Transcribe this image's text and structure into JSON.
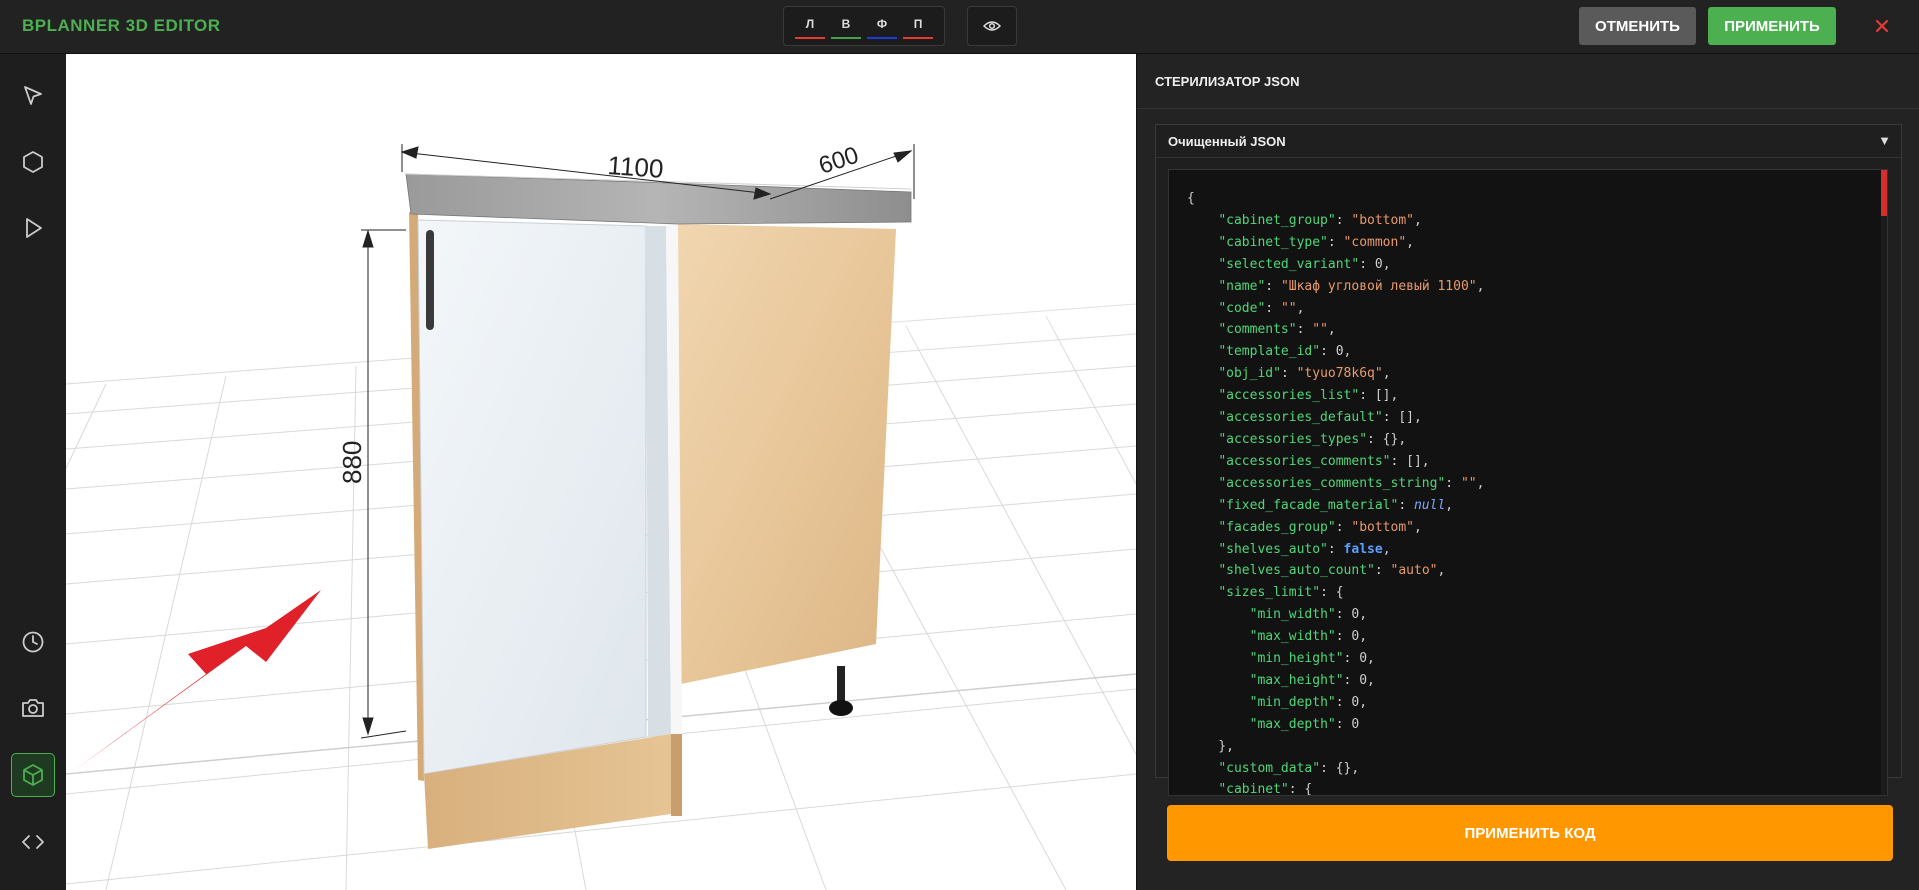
{
  "header": {
    "title": "BPLANNER 3D EDITOR",
    "view_buttons": [
      {
        "label": "Л",
        "color": "#e53935"
      },
      {
        "label": "В",
        "color": "#43a047"
      },
      {
        "label": "Ф",
        "color": "#1e3ad6"
      },
      {
        "label": "П",
        "color": "#e53935"
      }
    ],
    "eye_icon": "eye-icon",
    "cancel_label": "ОТМЕНИТЬ",
    "apply_label": "ПРИМЕНИТЬ",
    "close_icon": "close-icon"
  },
  "sidebar": {
    "tools": [
      {
        "name": "select-tool",
        "icon": "cursor-icon"
      },
      {
        "name": "shape-tool",
        "icon": "hexagon-icon"
      },
      {
        "name": "play-tool",
        "icon": "play-icon"
      },
      {
        "name": "history-tool",
        "icon": "clock-icon"
      },
      {
        "name": "camera-tool",
        "icon": "camera-icon"
      },
      {
        "name": "cube-tool",
        "icon": "cube-icon",
        "active": true
      },
      {
        "name": "code-tool",
        "icon": "code-icon"
      }
    ]
  },
  "viewport": {
    "dim_width": "1100",
    "dim_depth": "600",
    "dim_height": "880"
  },
  "panel": {
    "title": "СТЕРИЛИЗАТОР JSON",
    "accordion_title": "Очищенный JSON",
    "accordion_arrow": "▼",
    "code_lines": [
      [
        {
          "t": "p",
          "v": "{"
        }
      ],
      [
        {
          "t": "p",
          "v": "    "
        },
        {
          "t": "k",
          "v": "\"cabinet_group\""
        },
        {
          "t": "p",
          "v": ": "
        },
        {
          "t": "s",
          "v": "\"bottom\""
        },
        {
          "t": "p",
          "v": ","
        }
      ],
      [
        {
          "t": "p",
          "v": "    "
        },
        {
          "t": "k",
          "v": "\"cabinet_type\""
        },
        {
          "t": "p",
          "v": ": "
        },
        {
          "t": "s",
          "v": "\"common\""
        },
        {
          "t": "p",
          "v": ","
        }
      ],
      [
        {
          "t": "p",
          "v": "    "
        },
        {
          "t": "k",
          "v": "\"selected_variant\""
        },
        {
          "t": "p",
          "v": ": "
        },
        {
          "t": "n",
          "v": "0"
        },
        {
          "t": "p",
          "v": ","
        }
      ],
      [
        {
          "t": "p",
          "v": "    "
        },
        {
          "t": "k",
          "v": "\"name\""
        },
        {
          "t": "p",
          "v": ": "
        },
        {
          "t": "s",
          "v": "\"Шкаф угловой левый 1100\""
        },
        {
          "t": "p",
          "v": ","
        }
      ],
      [
        {
          "t": "p",
          "v": "    "
        },
        {
          "t": "k",
          "v": "\"code\""
        },
        {
          "t": "p",
          "v": ": "
        },
        {
          "t": "s",
          "v": "\"\""
        },
        {
          "t": "p",
          "v": ","
        }
      ],
      [
        {
          "t": "p",
          "v": "    "
        },
        {
          "t": "k",
          "v": "\"comments\""
        },
        {
          "t": "p",
          "v": ": "
        },
        {
          "t": "s",
          "v": "\"\""
        },
        {
          "t": "p",
          "v": ","
        }
      ],
      [
        {
          "t": "p",
          "v": "    "
        },
        {
          "t": "k",
          "v": "\"template_id\""
        },
        {
          "t": "p",
          "v": ": "
        },
        {
          "t": "n",
          "v": "0"
        },
        {
          "t": "p",
          "v": ","
        }
      ],
      [
        {
          "t": "p",
          "v": "    "
        },
        {
          "t": "k",
          "v": "\"obj_id\""
        },
        {
          "t": "p",
          "v": ": "
        },
        {
          "t": "s",
          "v": "\"tyuo78k6q\""
        },
        {
          "t": "p",
          "v": ","
        }
      ],
      [
        {
          "t": "p",
          "v": "    "
        },
        {
          "t": "k",
          "v": "\"accessories_list\""
        },
        {
          "t": "p",
          "v": ": [],"
        }
      ],
      [
        {
          "t": "p",
          "v": "    "
        },
        {
          "t": "k",
          "v": "\"accessories_default\""
        },
        {
          "t": "p",
          "v": ": [],"
        }
      ],
      [
        {
          "t": "p",
          "v": "    "
        },
        {
          "t": "k",
          "v": "\"accessories_types\""
        },
        {
          "t": "p",
          "v": ": {},"
        }
      ],
      [
        {
          "t": "p",
          "v": "    "
        },
        {
          "t": "k",
          "v": "\"accessories_comments\""
        },
        {
          "t": "p",
          "v": ": [],"
        }
      ],
      [
        {
          "t": "p",
          "v": "    "
        },
        {
          "t": "k",
          "v": "\"accessories_comments_string\""
        },
        {
          "t": "p",
          "v": ": "
        },
        {
          "t": "s",
          "v": "\"\""
        },
        {
          "t": "p",
          "v": ","
        }
      ],
      [
        {
          "t": "p",
          "v": "    "
        },
        {
          "t": "k",
          "v": "\"fixed_facade_material\""
        },
        {
          "t": "p",
          "v": ": "
        },
        {
          "t": "nl",
          "v": "null"
        },
        {
          "t": "p",
          "v": ","
        }
      ],
      [
        {
          "t": "p",
          "v": "    "
        },
        {
          "t": "k",
          "v": "\"facades_group\""
        },
        {
          "t": "p",
          "v": ": "
        },
        {
          "t": "s",
          "v": "\"bottom\""
        },
        {
          "t": "p",
          "v": ","
        }
      ],
      [
        {
          "t": "p",
          "v": "    "
        },
        {
          "t": "k",
          "v": "\"shelves_auto\""
        },
        {
          "t": "p",
          "v": ": "
        },
        {
          "t": "kw",
          "v": "false"
        },
        {
          "t": "p",
          "v": ","
        }
      ],
      [
        {
          "t": "p",
          "v": "    "
        },
        {
          "t": "k",
          "v": "\"shelves_auto_count\""
        },
        {
          "t": "p",
          "v": ": "
        },
        {
          "t": "s",
          "v": "\"auto\""
        },
        {
          "t": "p",
          "v": ","
        }
      ],
      [
        {
          "t": "p",
          "v": "    "
        },
        {
          "t": "k",
          "v": "\"sizes_limit\""
        },
        {
          "t": "p",
          "v": ": {"
        }
      ],
      [
        {
          "t": "p",
          "v": "        "
        },
        {
          "t": "k",
          "v": "\"min_width\""
        },
        {
          "t": "p",
          "v": ": "
        },
        {
          "t": "n",
          "v": "0"
        },
        {
          "t": "p",
          "v": ","
        }
      ],
      [
        {
          "t": "p",
          "v": "        "
        },
        {
          "t": "k",
          "v": "\"max_width\""
        },
        {
          "t": "p",
          "v": ": "
        },
        {
          "t": "n",
          "v": "0"
        },
        {
          "t": "p",
          "v": ","
        }
      ],
      [
        {
          "t": "p",
          "v": "        "
        },
        {
          "t": "k",
          "v": "\"min_height\""
        },
        {
          "t": "p",
          "v": ": "
        },
        {
          "t": "n",
          "v": "0"
        },
        {
          "t": "p",
          "v": ","
        }
      ],
      [
        {
          "t": "p",
          "v": "        "
        },
        {
          "t": "k",
          "v": "\"max_height\""
        },
        {
          "t": "p",
          "v": ": "
        },
        {
          "t": "n",
          "v": "0"
        },
        {
          "t": "p",
          "v": ","
        }
      ],
      [
        {
          "t": "p",
          "v": "        "
        },
        {
          "t": "k",
          "v": "\"min_depth\""
        },
        {
          "t": "p",
          "v": ": "
        },
        {
          "t": "n",
          "v": "0"
        },
        {
          "t": "p",
          "v": ","
        }
      ],
      [
        {
          "t": "p",
          "v": "        "
        },
        {
          "t": "k",
          "v": "\"max_depth\""
        },
        {
          "t": "p",
          "v": ": "
        },
        {
          "t": "n",
          "v": "0"
        }
      ],
      [
        {
          "t": "p",
          "v": "    },"
        }
      ],
      [
        {
          "t": "p",
          "v": "    "
        },
        {
          "t": "k",
          "v": "\"custom_data\""
        },
        {
          "t": "p",
          "v": ": {},"
        }
      ],
      [
        {
          "t": "p",
          "v": "    "
        },
        {
          "t": "k",
          "v": "\"cabinet\""
        },
        {
          "t": "p",
          "v": ": {"
        }
      ]
    ],
    "apply_code_label": "ПРИМЕНИТЬ КОД"
  }
}
